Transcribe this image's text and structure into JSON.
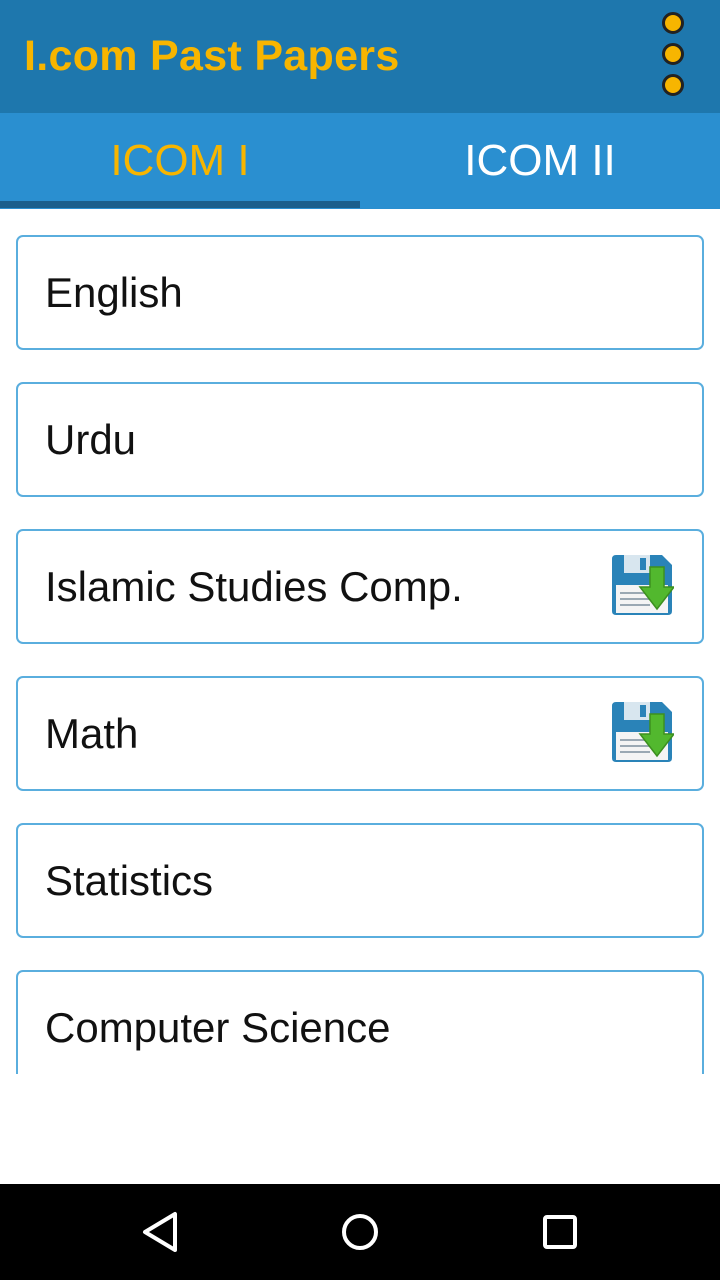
{
  "app": {
    "title": "I.com Past Papers"
  },
  "tabs": [
    {
      "label": "ICOM I",
      "selected": true
    },
    {
      "label": "ICOM II",
      "selected": false
    }
  ],
  "subjects": [
    {
      "label": "English",
      "download_icon": false
    },
    {
      "label": "Urdu",
      "download_icon": false
    },
    {
      "label": "Islamic Studies Comp.",
      "download_icon": true
    },
    {
      "label": "Math",
      "download_icon": true
    },
    {
      "label": "Statistics",
      "download_icon": false
    },
    {
      "label": "Computer Science",
      "download_icon": false
    }
  ],
  "icons": {
    "overflow": "overflow-menu-icon",
    "download": "floppy-download-icon",
    "back": "back-triangle-icon",
    "home": "home-circle-icon",
    "recents": "recents-square-icon"
  },
  "colors": {
    "appbar": "#1e77ad",
    "tabbar": "#2a8fd0",
    "accent": "#f7b500",
    "card_border": "#5aaede"
  }
}
